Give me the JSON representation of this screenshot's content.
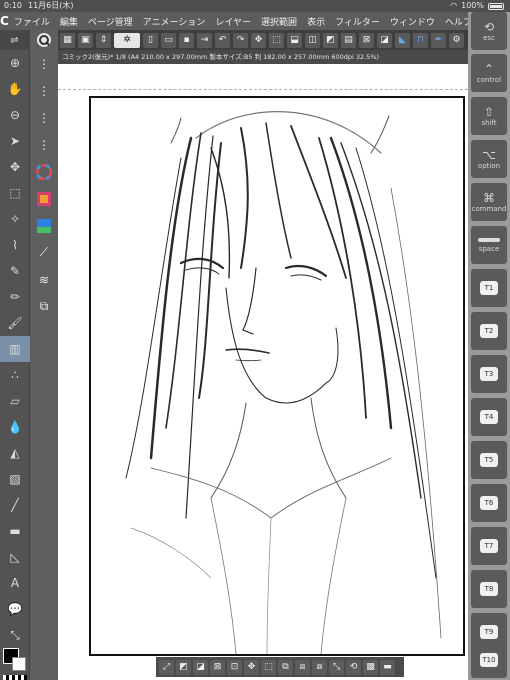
{
  "status_bar": {
    "time": "0:10",
    "date": "11月6日(木)",
    "battery": "100%"
  },
  "menu": {
    "logo": "C",
    "items": [
      "ファイル",
      "編集",
      "ページ管理",
      "アニメーション",
      "レイヤー",
      "選択範囲",
      "表示",
      "フィルター",
      "ウィンドウ",
      "ヘルプ"
    ]
  },
  "document": {
    "tab_title": "コミック2(復元)* 1/8 (A4 210.00 x 297.00mm 製本サイズ:B5 判 182.00 x 257.00mm 600dpi 32.5%)"
  },
  "edge_keys": [
    {
      "label": "esc",
      "glyph": "⟲"
    },
    {
      "label": "control",
      "glyph": "⌃"
    },
    {
      "label": "shift",
      "glyph": "⇧"
    },
    {
      "label": "option",
      "glyph": "⌥"
    },
    {
      "label": "command",
      "glyph": "⌘"
    },
    {
      "label": "space",
      "glyph": ""
    },
    {
      "label": "T1"
    },
    {
      "label": "T2"
    },
    {
      "label": "T3"
    },
    {
      "label": "T4"
    },
    {
      "label": "T5"
    },
    {
      "label": "T6"
    },
    {
      "label": "T7"
    },
    {
      "label": "T8"
    },
    {
      "label": "T9"
    },
    {
      "label": "T10"
    }
  ],
  "colors": {
    "main": "#000000",
    "sub": "#ffffff",
    "accent": "#7a8fa8"
  }
}
